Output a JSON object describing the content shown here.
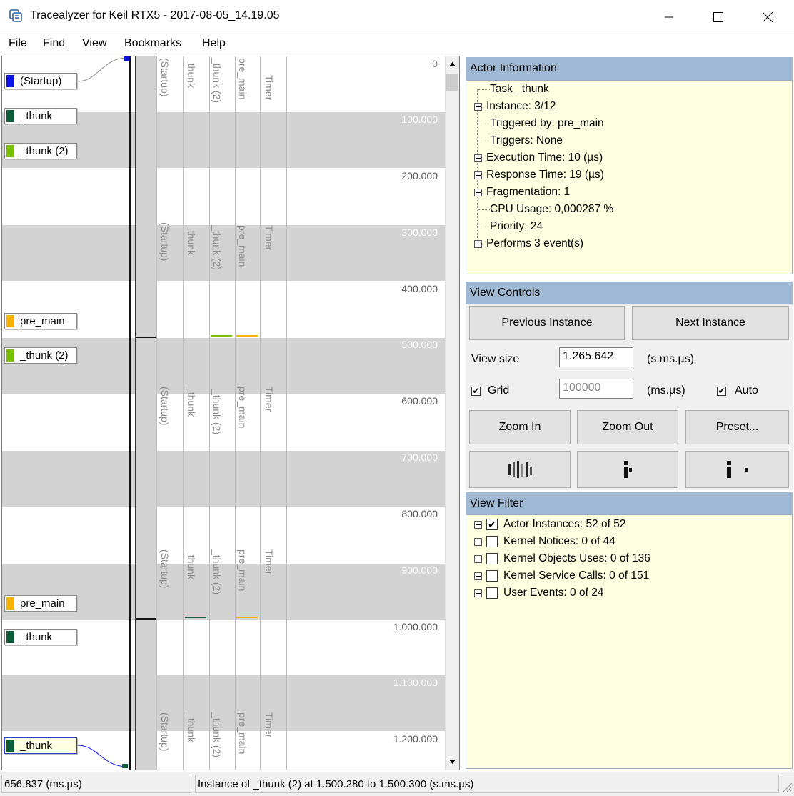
{
  "window": {
    "title": "Tracealyzer for Keil RTX5 - 2017-08-05_14.19.05",
    "icons": [
      "app-icon",
      "minimize-icon",
      "maximize-icon",
      "close-icon"
    ]
  },
  "menu": [
    "File",
    "Find",
    "View",
    "Bookmarks",
    "Help"
  ],
  "trace": {
    "actors": [
      {
        "label": "(Startup)",
        "color": "#0a14e6"
      },
      {
        "label": "_thunk",
        "color": "#0d5c3a"
      },
      {
        "label": "_thunk (2)",
        "color": "#78c000"
      },
      {
        "label": "pre_main",
        "color": "#f7b100"
      },
      {
        "label": "_thunk (2)",
        "color": "#78c000"
      },
      {
        "label": "pre_main",
        "color": "#f7b100"
      },
      {
        "label": "_thunk",
        "color": "#0d5c3a"
      },
      {
        "label": "_thunk",
        "color": "#0d5c3a"
      }
    ],
    "columns": [
      "(Startup)",
      "_thunk",
      "_thunk (2)",
      "pre_main",
      "Timer"
    ],
    "ticks": [
      "0",
      "100.000",
      "200.000",
      "300.000",
      "400.000",
      "500.000",
      "600.000",
      "700.000",
      "800.000",
      "900.000",
      "1.000.000",
      "1.100.000",
      "1.200.000"
    ]
  },
  "actor_info": {
    "header": "Actor Information",
    "rows": [
      {
        "text": "Task _thunk",
        "expandable": false
      },
      {
        "text": "Instance: 3/12",
        "expandable": true
      },
      {
        "text": "Triggered by: pre_main",
        "expandable": false
      },
      {
        "text": "Triggers: None",
        "expandable": false
      },
      {
        "text": "Execution Time: 10 (µs)",
        "expandable": true
      },
      {
        "text": "Response Time: 19 (µs)",
        "expandable": true
      },
      {
        "text": "Fragmentation: 1",
        "expandable": true
      },
      {
        "text": "CPU Usage: 0,000287 %",
        "expandable": false
      },
      {
        "text": "Priority: 24",
        "expandable": false
      },
      {
        "text": "Performs 3 event(s)",
        "expandable": true
      }
    ]
  },
  "view_controls": {
    "header": "View Controls",
    "previous_instance": "Previous Instance",
    "next_instance": "Next Instance",
    "view_size_label": "View size",
    "view_size_value": "1.265.642",
    "view_size_unit": "(s.ms.µs)",
    "grid_label": "Grid",
    "grid_checked": true,
    "grid_value": "100000",
    "grid_unit": "(ms.µs)",
    "auto_label": "Auto",
    "auto_checked": true,
    "zoom_in": "Zoom In",
    "zoom_out": "Zoom Out",
    "preset": "Preset..."
  },
  "view_filter": {
    "header": "View Filter",
    "rows": [
      {
        "text": "Actor Instances: 52 of 52",
        "checked": true
      },
      {
        "text": "Kernel Notices: 0 of 44",
        "checked": false
      },
      {
        "text": "Kernel Objects Uses: 0 of 136",
        "checked": false
      },
      {
        "text": "Kernel Service Calls: 0 of 151",
        "checked": false
      },
      {
        "text": "User Events: 0 of 24",
        "checked": false
      }
    ]
  },
  "status": {
    "left": "656.837 (ms.µs)",
    "right": "Instance of _thunk (2) at 1.500.280 to 1.500.300 (s.ms.µs)"
  }
}
